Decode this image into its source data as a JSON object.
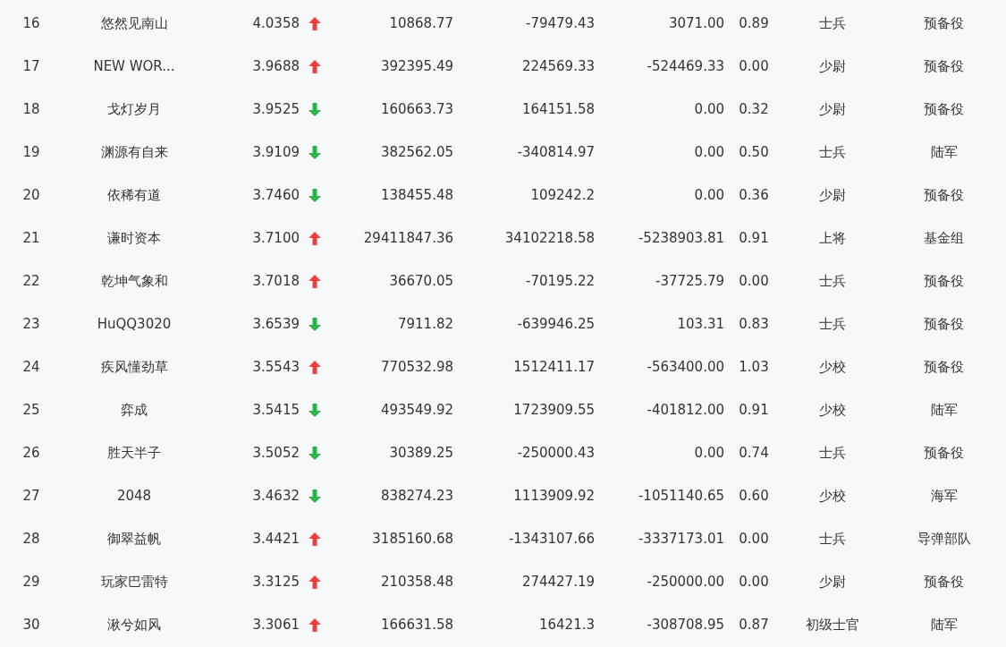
{
  "rows": [
    {
      "number": "16",
      "name": "悠然见南山",
      "score": "4.0358",
      "rising": true,
      "column_5": "10868.77",
      "column_6": "-79479.43",
      "column_7": "3071.00",
      "column_8": "0.89",
      "column_9": "士兵",
      "column_10": "预备役"
    },
    {
      "number": "17",
      "name": "NEW WOR...",
      "score": "3.9688",
      "rising": true,
      "column_5": "392395.49",
      "column_6": "224569.33",
      "column_7": "-524469.33",
      "column_8": "0.00",
      "column_9": "少尉",
      "column_10": "预备役"
    },
    {
      "number": "18",
      "name": "戈灯岁月",
      "score": "3.9525",
      "rising": false,
      "column_5": "160663.73",
      "column_6": "164151.58",
      "column_7": "0.00",
      "column_8": "0.32",
      "column_9": "少尉",
      "column_10": "预备役"
    },
    {
      "number": "19",
      "name": "渊源有自来",
      "score": "3.9109",
      "rising": false,
      "column_5": "382562.05",
      "column_6": "-340814.97",
      "column_7": "0.00",
      "column_8": "0.50",
      "column_9": "士兵",
      "column_10": "陆军"
    },
    {
      "number": "20",
      "name": "依稀有道",
      "score": "3.7460",
      "rising": false,
      "column_5": "138455.48",
      "column_6": "109242.2",
      "column_7": "0.00",
      "column_8": "0.36",
      "column_9": "少尉",
      "column_10": "预备役"
    },
    {
      "number": "21",
      "name": "谦时资本",
      "score": "3.7100",
      "rising": true,
      "column_5": "29411847.36",
      "column_6": "34102218.58",
      "column_7": "-5238903.81",
      "column_8": "0.91",
      "column_9": "上将",
      "column_10": "基金组"
    },
    {
      "number": "22",
      "name": "乾坤气象和",
      "score": "3.7018",
      "rising": true,
      "column_5": "36670.05",
      "column_6": "-70195.22",
      "column_7": "-37725.79",
      "column_8": "0.00",
      "column_9": "士兵",
      "column_10": "预备役"
    },
    {
      "number": "23",
      "name": "HuQQ3020",
      "score": "3.6539",
      "rising": false,
      "column_5": "7911.82",
      "column_6": "-639946.25",
      "column_7": "103.31",
      "column_8": "0.83",
      "column_9": "士兵",
      "column_10": "预备役"
    },
    {
      "number": "24",
      "name": "疾风懂劲草",
      "score": "3.5543",
      "rising": true,
      "column_5": "770532.98",
      "column_6": "1512411.17",
      "column_7": "-563400.00",
      "column_8": "1.03",
      "column_9": "少校",
      "column_10": "预备役"
    },
    {
      "number": "25",
      "name": "弈成",
      "score": "3.5415",
      "rising": false,
      "column_5": "493549.92",
      "column_6": "1723909.55",
      "column_7": "-401812.00",
      "column_8": "0.91",
      "column_9": "少校",
      "column_10": "陆军"
    },
    {
      "number": "26",
      "name": "胜天半子",
      "score": "3.5052",
      "rising": false,
      "column_5": "30389.25",
      "column_6": "-250000.43",
      "column_7": "0.00",
      "column_8": "0.74",
      "column_9": "士兵",
      "column_10": "预备役"
    },
    {
      "number": "27",
      "name": "2048",
      "score": "3.4632",
      "rising": false,
      "column_5": "838274.23",
      "column_6": "1113909.92",
      "column_7": "-1051140.65",
      "column_8": "0.60",
      "column_9": "少校",
      "column_10": "海军"
    },
    {
      "number": "28",
      "name": "御翠益帆",
      "score": "3.4421",
      "rising": true,
      "column_5": "3185160.68",
      "column_6": "-1343107.66",
      "column_7": "-3337173.01",
      "column_8": "0.00",
      "column_9": "士兵",
      "column_10": "导弹部队"
    },
    {
      "number": "29",
      "name": "玩家巴雷特",
      "score": "3.3125",
      "rising": true,
      "column_5": "210358.48",
      "column_6": "274427.19",
      "column_7": "-250000.00",
      "column_8": "0.00",
      "column_9": "少尉",
      "column_10": "预备役"
    },
    {
      "number": "30",
      "name": "湫兮如风",
      "score": "3.3061",
      "rising": true,
      "column_5": "166631.58",
      "column_6": "16421.3",
      "column_7": "-308708.95",
      "column_8": "0.87",
      "column_9": "初级士官",
      "column_10": "陆军"
    }
  ]
}
